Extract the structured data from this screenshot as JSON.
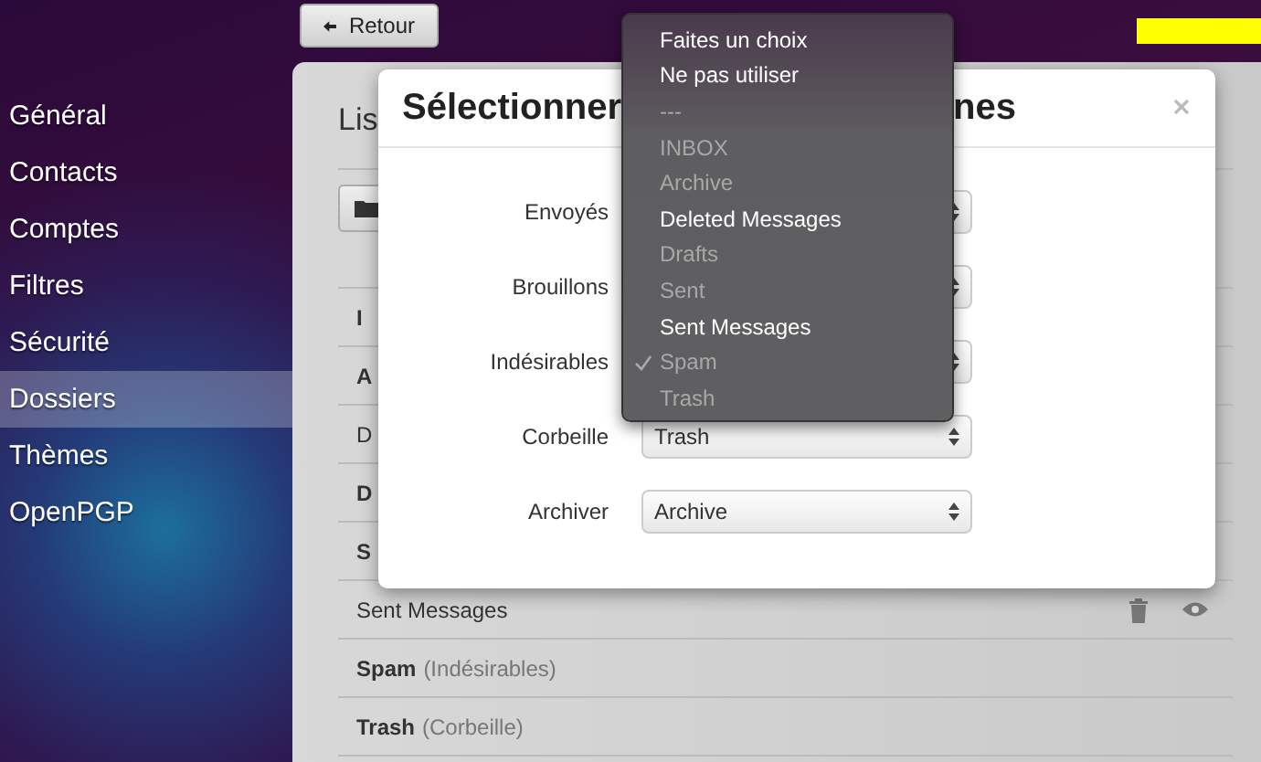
{
  "back_button": {
    "label": "Retour"
  },
  "sidebar": {
    "items": [
      {
        "label": "Général",
        "selected": false
      },
      {
        "label": "Contacts",
        "selected": false
      },
      {
        "label": "Comptes",
        "selected": false
      },
      {
        "label": "Filtres",
        "selected": false
      },
      {
        "label": "Sécurité",
        "selected": false
      },
      {
        "label": "Dossiers",
        "selected": true
      },
      {
        "label": "Thèmes",
        "selected": false
      },
      {
        "label": "OpenPGP",
        "selected": false
      }
    ]
  },
  "panel": {
    "title": "Lis",
    "folders": [
      {
        "name": "I",
        "system": true,
        "actions": false
      },
      {
        "name": "A",
        "system": true,
        "actions": false
      },
      {
        "name": "D",
        "system": false,
        "actions": false
      },
      {
        "name": "D",
        "system": true,
        "actions": false
      },
      {
        "name": "S",
        "system": true,
        "actions": false
      },
      {
        "name": "Sent Messages",
        "system": false,
        "actions": true
      },
      {
        "name": "Spam",
        "note": "(Indésirables)",
        "system": true,
        "actions": false
      },
      {
        "name": "Trash",
        "note": "(Corbeille)",
        "system": true,
        "actions": false
      }
    ]
  },
  "modal": {
    "title_parts": [
      "Sélectionner",
      "nes"
    ],
    "fields": [
      {
        "label": "Envoyés"
      },
      {
        "label": "Brouillons"
      },
      {
        "label": "Indésirables"
      },
      {
        "label": "Corbeille",
        "value": "Trash"
      },
      {
        "label": "Archiver",
        "value": "Archive"
      }
    ]
  },
  "dropdown": {
    "options": [
      {
        "label": "Faites un choix",
        "disabled": false,
        "selected": false
      },
      {
        "label": "Ne pas utiliser",
        "disabled": false,
        "selected": false
      },
      {
        "label": "---",
        "disabled": true,
        "selected": false
      },
      {
        "label": "INBOX",
        "disabled": true,
        "selected": false
      },
      {
        "label": "Archive",
        "disabled": true,
        "selected": false
      },
      {
        "label": "Deleted Messages",
        "disabled": false,
        "selected": false
      },
      {
        "label": "Drafts",
        "disabled": true,
        "selected": false
      },
      {
        "label": "Sent",
        "disabled": true,
        "selected": false
      },
      {
        "label": "Sent Messages",
        "disabled": false,
        "selected": false
      },
      {
        "label": "Spam",
        "disabled": true,
        "selected": true
      },
      {
        "label": "Trash",
        "disabled": true,
        "selected": false
      }
    ]
  }
}
